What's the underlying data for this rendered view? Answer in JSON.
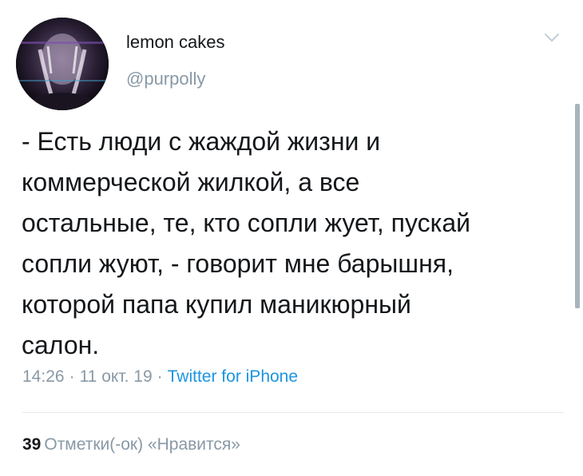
{
  "user": {
    "display_name": "lemon cakes",
    "handle": "@purpolly",
    "avatar_icon": "avatar-photo"
  },
  "tweet": {
    "lines": [
      "- Есть люди с жаждой жизни и",
      "коммерческой жилкой, а все",
      "остальные, те, кто сопли жует, пускай",
      "сопли жуют, - говорит мне барышня,",
      "которой папа купил маникюрный",
      "салон."
    ],
    "time": "14:26",
    "date": "11 окт. 19",
    "separator": "·",
    "source": "Twitter for iPhone"
  },
  "stats": {
    "likes_count": "39",
    "likes_label": "Отметки(-ок) «Нравится»"
  },
  "icons": {
    "menu": "chevron-down-icon"
  },
  "colors": {
    "text": "#14171a",
    "muted": "#8899a6",
    "link": "#1b95e0",
    "divider": "#e1e8ed"
  }
}
